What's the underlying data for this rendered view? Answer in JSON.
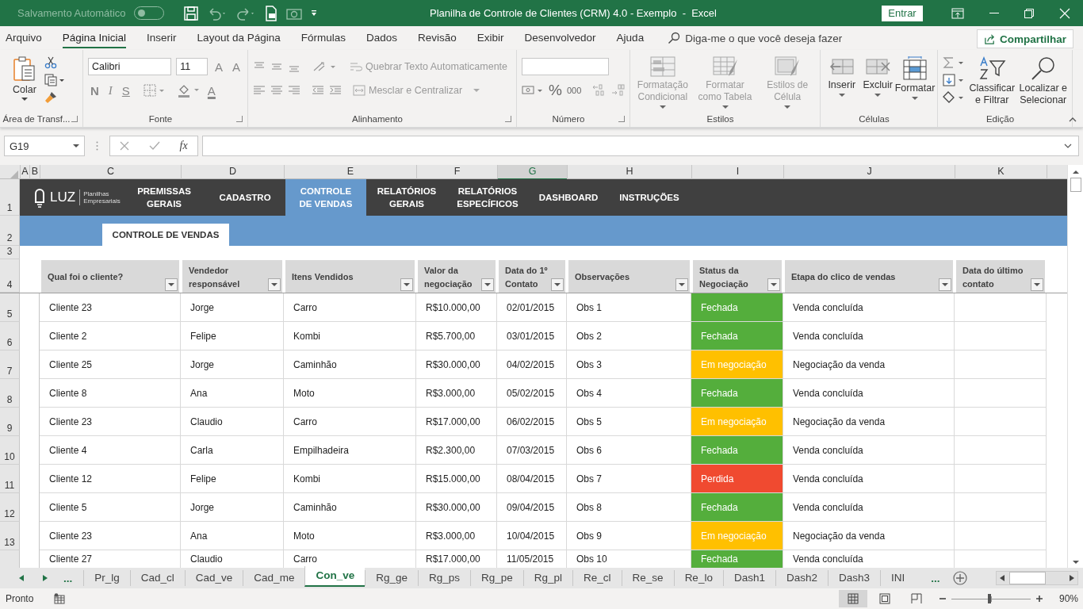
{
  "title_bar": {
    "autosave_label": "Salvamento Automático",
    "autosave_on": false,
    "title": "Planilha de Controle de Clientes (CRM) 4.0 - Exemplo  -  Excel",
    "sign_in": "Entrar"
  },
  "menu_tabs": [
    {
      "label": "Arquivo",
      "selected": false
    },
    {
      "label": "Página Inicial",
      "selected": true
    },
    {
      "label": "Inserir",
      "selected": false
    },
    {
      "label": "Layout da Página",
      "selected": false
    },
    {
      "label": "Fórmulas",
      "selected": false
    },
    {
      "label": "Dados",
      "selected": false
    },
    {
      "label": "Revisão",
      "selected": false
    },
    {
      "label": "Exibir",
      "selected": false
    },
    {
      "label": "Desenvolvedor",
      "selected": false
    },
    {
      "label": "Ajuda",
      "selected": false
    }
  ],
  "tell_me": "Diga-me o que você deseja fazer",
  "share": "Compartilhar",
  "ribbon": {
    "clipboard": {
      "paste": "Colar",
      "label": "Área de Transf..."
    },
    "font": {
      "font_name": "Calibri",
      "font_size": "11",
      "grow": "A",
      "shrink": "A",
      "bold": "N",
      "italic": "I",
      "underline": "S",
      "font_paint": "A",
      "label": "Fonte"
    },
    "alignment": {
      "wrap": "Quebrar Texto Automaticamente",
      "merge": "Mesclar e Centralizar",
      "disabled": true,
      "label": "Alinhamento"
    },
    "number": {
      "percent": "%",
      "thousands": "000",
      "label": "Número"
    },
    "styles": {
      "label": "Estilos",
      "buttons": [
        {
          "kind": "conditional",
          "label": "Formatação Condicional",
          "disabled": true
        },
        {
          "kind": "table",
          "label": "Formatar como Tabela",
          "disabled": true
        },
        {
          "kind": "cellstyle",
          "label": "Estilos de Célula",
          "disabled": true
        }
      ]
    },
    "cells": {
      "label": "Células",
      "buttons": [
        {
          "kind": "insert",
          "label": "Inserir",
          "disabled": false
        },
        {
          "kind": "delete",
          "label": "Excluir",
          "disabled": false
        },
        {
          "kind": "format",
          "label": "Formatar",
          "disabled": false
        }
      ]
    },
    "editing": {
      "label": "Edição",
      "buttons": [
        {
          "kind": "sort",
          "label": "Classificar e Filtrar"
        },
        {
          "kind": "find",
          "label": "Localizar e Selecionar"
        }
      ]
    }
  },
  "formula_bar": {
    "name_box": "G19",
    "function_label": "fx"
  },
  "column_headers": [
    {
      "label": "A",
      "selected": false
    },
    {
      "label": "B",
      "selected": false
    },
    {
      "label": "C",
      "selected": false
    },
    {
      "label": "D",
      "selected": false
    },
    {
      "label": "E",
      "selected": false
    },
    {
      "label": "F",
      "selected": false
    },
    {
      "label": "G",
      "selected": true
    },
    {
      "label": "H",
      "selected": false
    },
    {
      "label": "I",
      "selected": false
    },
    {
      "label": "J",
      "selected": false
    },
    {
      "label": "K",
      "selected": false
    }
  ],
  "row_numbers": [
    "1",
    "2",
    "3",
    "4"
  ],
  "nav": {
    "logo": "LUZ",
    "logo_sub": "Planilhas Empresariais",
    "items": [
      {
        "label": "PREMISSAS GERAIS",
        "selected": false
      },
      {
        "label": "CADASTRO",
        "selected": false
      },
      {
        "label": "CONTROLE DE VENDAS",
        "selected": true
      },
      {
        "label": "RELATÓRIOS GERAIS",
        "selected": false
      },
      {
        "label": "RELATÓRIOS ESPECÍFICOS",
        "selected": false
      },
      {
        "label": "DASHBOARD",
        "selected": false
      },
      {
        "label": "INSTRUÇÕES",
        "selected": false
      }
    ]
  },
  "page_tab": "CONTROLE DE VENDAS",
  "table": {
    "columns": [
      "Qual foi o cliente?",
      "Vendedor responsável",
      "Itens Vendidos",
      "Valor da negociação",
      "Data do 1º Contato",
      "Observações",
      "Status da Negociação",
      "Etapa do clico de vendas",
      "Data do último contato"
    ],
    "rows": [
      {
        "row_number": "5",
        "cells": [
          "Cliente 23",
          "Jorge",
          "Carro",
          "R$10.000,00",
          "02/01/2015",
          "Obs 1"
        ],
        "status": {
          "label": "Fechada",
          "color": "#54ae3c"
        },
        "stage": "Venda concluída"
      },
      {
        "row_number": "6",
        "cells": [
          "Cliente 2",
          "Felipe",
          "Kombi",
          "R$5.700,00",
          "03/01/2015",
          "Obs 2"
        ],
        "status": {
          "label": "Fechada",
          "color": "#54ae3c"
        },
        "stage": "Venda concluída"
      },
      {
        "row_number": "7",
        "cells": [
          "Cliente 25",
          "Jorge",
          "Caminhão",
          "R$30.000,00",
          "04/02/2015",
          "Obs 3"
        ],
        "status": {
          "label": "Em negociação",
          "color": "#ffc000"
        },
        "stage": "Negociação da venda"
      },
      {
        "row_number": "8",
        "cells": [
          "Cliente 8",
          "Ana",
          "Moto",
          "R$3.000,00",
          "05/02/2015",
          "Obs 4"
        ],
        "status": {
          "label": "Fechada",
          "color": "#54ae3c"
        },
        "stage": "Venda concluída"
      },
      {
        "row_number": "9",
        "cells": [
          "Cliente 23",
          "Claudio",
          "Carro",
          "R$17.000,00",
          "06/02/2015",
          "Obs 5"
        ],
        "status": {
          "label": "Em negociação",
          "color": "#ffc000"
        },
        "stage": "Negociação da venda"
      },
      {
        "row_number": "10",
        "cells": [
          "Cliente 4",
          "Carla",
          "Empilhadeira",
          "R$2.300,00",
          "07/03/2015",
          "Obs 6"
        ],
        "status": {
          "label": "Fechada",
          "color": "#54ae3c"
        },
        "stage": "Venda concluída"
      },
      {
        "row_number": "11",
        "cells": [
          "Cliente 12",
          "Felipe",
          "Kombi",
          "R$15.000,00",
          "08/04/2015",
          "Obs 7"
        ],
        "status": {
          "label": "Perdida",
          "color": "#f04a30"
        },
        "stage": "Venda concluída"
      },
      {
        "row_number": "12",
        "cells": [
          "Cliente 5",
          "Jorge",
          "Caminhão",
          "R$30.000,00",
          "09/04/2015",
          "Obs 8"
        ],
        "status": {
          "label": "Fechada",
          "color": "#54ae3c"
        },
        "stage": "Venda concluída"
      },
      {
        "row_number": "13",
        "cells": [
          "Cliente 23",
          "Ana",
          "Moto",
          "R$3.000,00",
          "10/04/2015",
          "Obs 9"
        ],
        "status": {
          "label": "Em negociação",
          "color": "#ffc000"
        },
        "stage": "Negociação da venda"
      },
      {
        "cells": [
          "Cliente 27",
          "Claudio",
          "Carro",
          "R$17.000,00",
          "11/05/2015",
          "Obs 10"
        ],
        "status": {
          "label": "Fechada",
          "color": "#54ae3c"
        },
        "stage": "Venda concluída"
      }
    ]
  },
  "sheet_tabs": {
    "more_left": "...",
    "more_right": "...",
    "tabs": [
      {
        "label": "Pr_lg",
        "selected": false
      },
      {
        "label": "Cad_cl",
        "selected": false
      },
      {
        "label": "Cad_ve",
        "selected": false
      },
      {
        "label": "Cad_me",
        "selected": false
      },
      {
        "label": "Con_ve",
        "selected": true
      },
      {
        "label": "Rg_ge",
        "selected": false
      },
      {
        "label": "Rg_ps",
        "selected": false
      },
      {
        "label": "Rg_pe",
        "selected": false
      },
      {
        "label": "Rg_pl",
        "selected": false
      },
      {
        "label": "Re_cl",
        "selected": false
      },
      {
        "label": "Re_se",
        "selected": false
      },
      {
        "label": "Re_lo",
        "selected": false
      },
      {
        "label": "Dash1",
        "selected": false
      },
      {
        "label": "Dash2",
        "selected": false
      },
      {
        "label": "Dash3",
        "selected": false
      },
      {
        "label": "INI",
        "selected": false
      }
    ]
  },
  "status_bar": {
    "ready": "Pronto",
    "views": [
      {
        "kind": "normal",
        "selected": true
      },
      {
        "kind": "page_layout",
        "selected": false
      },
      {
        "kind": "page_break",
        "selected": false
      }
    ],
    "zoom": {
      "label": "90%",
      "level": 0.48
    }
  }
}
